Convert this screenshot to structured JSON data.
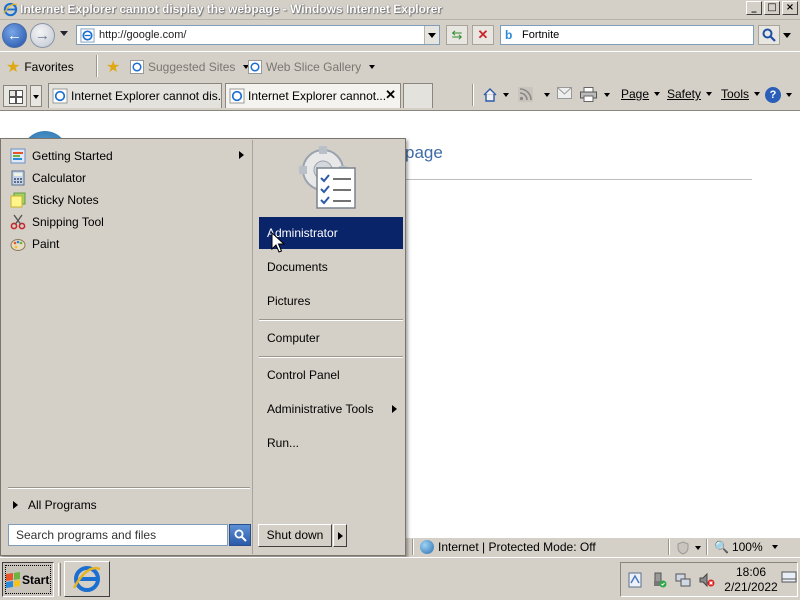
{
  "window": {
    "title": "Internet Explorer cannot display the webpage - Windows Internet Explorer",
    "min": "_",
    "max": "□",
    "close": "×"
  },
  "address": {
    "url": "http://google.com/"
  },
  "search": {
    "query": "Fortnite"
  },
  "favorites_bar": {
    "favorites_label": "Favorites",
    "suggested_sites": "Suggested Sites",
    "web_slice_gallery": "Web Slice Gallery"
  },
  "tabs": [
    {
      "label": "Internet Explorer cannot dis..."
    },
    {
      "label": "Internet Explorer cannot..."
    }
  ],
  "commands": {
    "page": "Page",
    "safety": "Safety",
    "tools": "Tools",
    "help": "?"
  },
  "page": {
    "heading_fragment": "page"
  },
  "statusbar": {
    "zone": "Internet | Protected Mode: Off",
    "zoom": "100%"
  },
  "start_menu": {
    "left_items": [
      {
        "label": "Getting Started",
        "icon": "getting-started-icon"
      },
      {
        "label": "Calculator",
        "icon": "calculator-icon"
      },
      {
        "label": "Sticky Notes",
        "icon": "sticky-notes-icon"
      },
      {
        "label": "Snipping Tool",
        "icon": "scissors-icon"
      },
      {
        "label": "Paint",
        "icon": "paint-palette-icon"
      }
    ],
    "all_programs": "All Programs",
    "search_placeholder": "Search programs and files",
    "right_items": [
      {
        "label": "Administrator",
        "highlighted": true
      },
      {
        "label": "Documents"
      },
      {
        "label": "Pictures"
      },
      {
        "label": "Computer"
      },
      {
        "label": "Control Panel"
      },
      {
        "label": "Administrative Tools"
      },
      {
        "label": "Run..."
      }
    ],
    "shutdown": "Shut down"
  },
  "taskbar": {
    "start_label": "Start",
    "clock_time": "18:06",
    "clock_date": "2/21/2022"
  },
  "colors": {
    "selection": "#0a246a",
    "chrome": "#d4d0c8",
    "link_blue": "#3e6ca5"
  }
}
